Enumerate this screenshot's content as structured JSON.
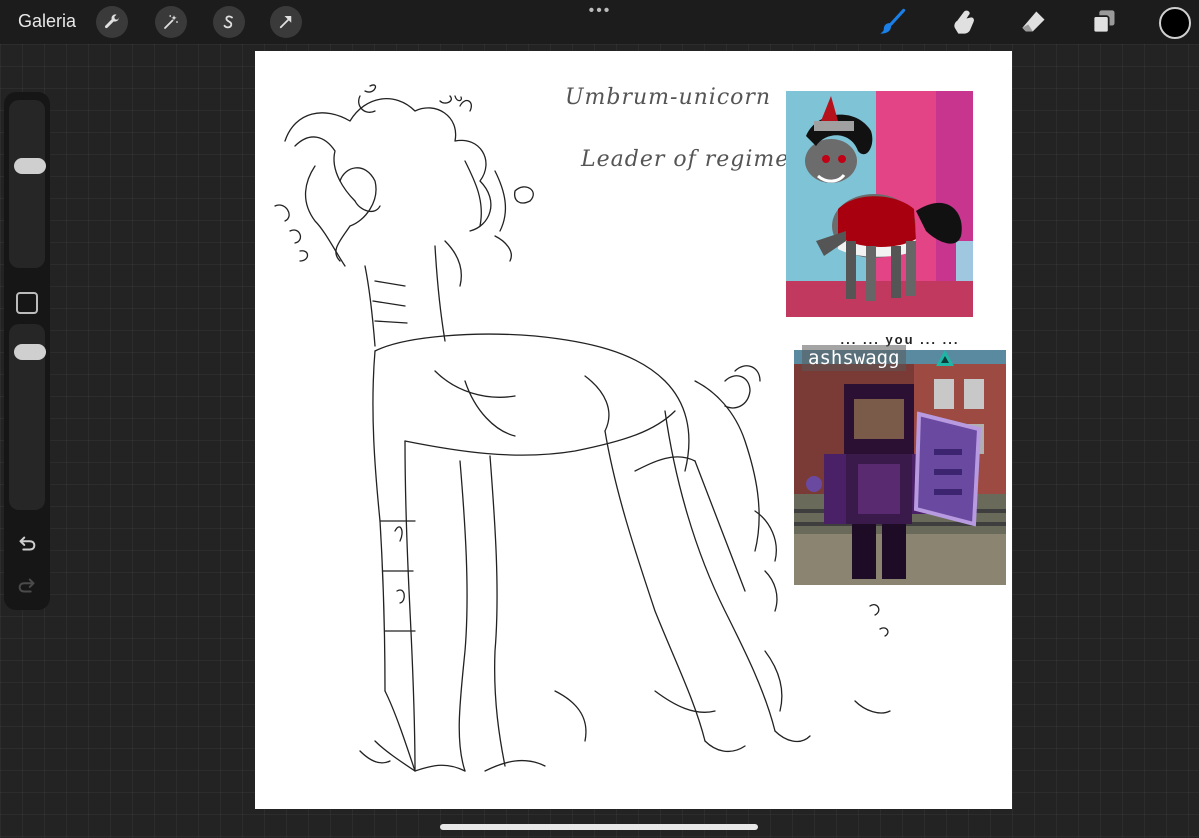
{
  "topbar": {
    "gallery_label": "Galeria"
  },
  "canvas": {
    "note_line1": "Umbrum-unicorn",
    "note_line2": "Leader of regime",
    "ref2_overlay_text": "... ... you ... ...",
    "ref2_nametag": "ashswagg"
  },
  "icons": {
    "actions": "wrench-icon",
    "adjustments": "magic-wand-icon",
    "selection": "selection-s-icon",
    "transform": "arrow-cursor-icon",
    "brush": "paintbrush-icon",
    "smudge": "smudge-finger-icon",
    "eraser": "eraser-icon",
    "layers": "layers-icon",
    "undo": "undo-arrow-icon",
    "redo": "redo-arrow-icon"
  },
  "colors": {
    "active_tool": "#1a7fe6",
    "current_color": "#000000"
  }
}
